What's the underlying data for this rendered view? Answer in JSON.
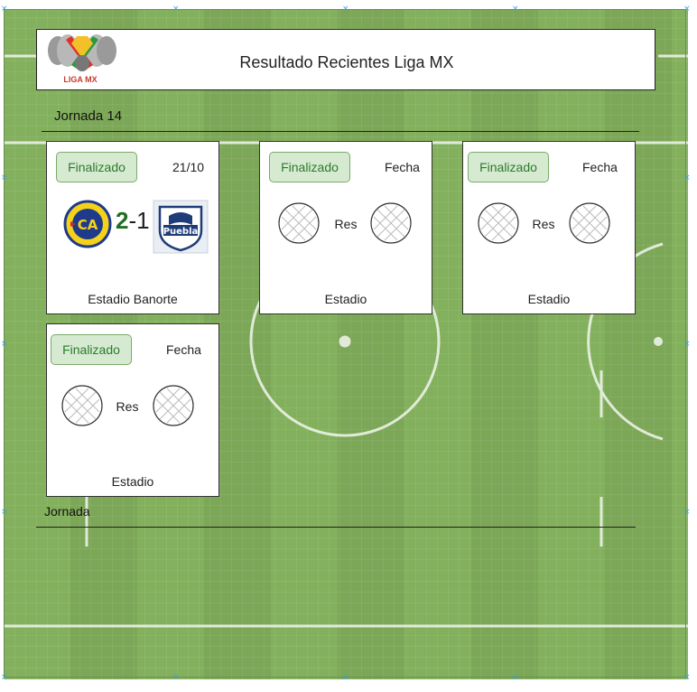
{
  "header": {
    "title": "Resultado Recientes Liga MX",
    "logo_text": "LIGA MX"
  },
  "sections": [
    {
      "label": "Jornada 14"
    },
    {
      "label": "Jornada"
    }
  ],
  "matches": [
    {
      "status": "Finalizado",
      "date": "21/10",
      "home_score": "2",
      "separator": "-",
      "away_score": "1",
      "venue": "Estadio Banorte",
      "home_team_icon": "club-america-crest",
      "away_team_icon": "club-puebla-crest"
    },
    {
      "status": "Finalizado",
      "date": "Fecha",
      "result": "Res",
      "venue": "Estadio"
    },
    {
      "status": "Finalizado",
      "date": "Fecha",
      "result": "Res",
      "venue": "Estadio"
    },
    {
      "status": "Finalizado",
      "date": "Fecha",
      "result": "Res",
      "venue": "Estadio"
    }
  ],
  "colors": {
    "pitch": "#82b05c",
    "status_bg": "#d6ead2",
    "status_text": "#2d7a2a",
    "score_home": "#1f6e24"
  }
}
